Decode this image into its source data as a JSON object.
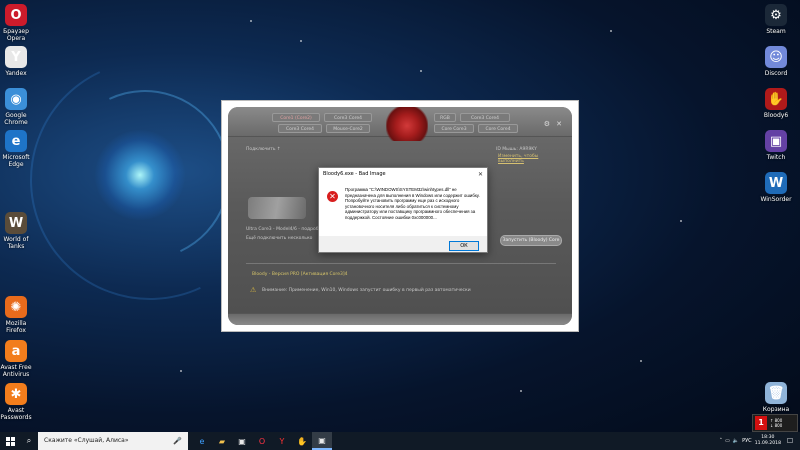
{
  "desktop": {
    "left_icons": [
      {
        "label": "Браузер\nOpera",
        "icon": "opera-icon",
        "color": "#cc1b2b",
        "glyph": "O"
      },
      {
        "label": "Yandex",
        "icon": "yandex-icon",
        "color": "#e8e8e8",
        "glyph": "Y"
      },
      {
        "label": "Google\nChrome",
        "icon": "chrome-icon",
        "color": "#3b8fd8",
        "glyph": "◉"
      },
      {
        "label": "Microsoft\nEdge",
        "icon": "edge-icon",
        "color": "#1e74c8",
        "glyph": "e"
      },
      {
        "label": "World of\nTanks",
        "icon": "world-of-tanks-icon",
        "color": "#5a4c3a",
        "glyph": "W"
      },
      {
        "label": "Mozilla\nFirefox",
        "icon": "firefox-icon",
        "color": "#e86b1c",
        "glyph": "✺"
      },
      {
        "label": "Avast Free\nAntivirus",
        "icon": "avast-icon",
        "color": "#f27d1c",
        "glyph": "a"
      },
      {
        "label": "Avast\nPasswords",
        "icon": "avast-passwords-icon",
        "color": "#f27d1c",
        "glyph": "✱"
      }
    ],
    "right_icons": [
      {
        "label": "Steam",
        "icon": "steam-icon",
        "color": "#1b2838",
        "glyph": "⚙"
      },
      {
        "label": "Discord",
        "icon": "discord-icon",
        "color": "#7289da",
        "glyph": "☺"
      },
      {
        "label": "Bloody6",
        "icon": "bloody-icon",
        "color": "#b01a1a",
        "glyph": "✋"
      },
      {
        "label": "Twitch",
        "icon": "twitch-icon",
        "color": "#6441a4",
        "glyph": "▣"
      },
      {
        "label": "WinSorder",
        "icon": "winsorder-icon",
        "color": "#1f6bb8",
        "glyph": "W"
      },
      {
        "label": "Корзина",
        "icon": "recycle-bin-icon",
        "color": "#8fb3d8",
        "glyph": "🗑"
      }
    ]
  },
  "app": {
    "tabs_row1": [
      "Core1 (Core2)",
      "Core3 Core4"
    ],
    "tabs_row2": [
      "Core3 Core4",
      "Mouse-Core2"
    ],
    "right_tabs_row1": [
      "RGB",
      "Core3 Core4"
    ],
    "right_tabs_row2": [
      "Core Core3",
      "Core Core4"
    ],
    "left_heading": "Подключить ↑",
    "right_status": "ID Мышь: A9R9KY",
    "right_link": "Изменить, чтобы\nвыполнить",
    "model_line": "Ultra Core3 - Model4/6 - подробнее",
    "sub_line": "Ещё подключить несколько",
    "gray_button": "Запустить (Bloody) Core",
    "version_line": "Bloody - Версия PRO [Активация Core3]4",
    "warning_line": "Внимание: Применение, Win10, Windows запустит ошибку в первый раз автоматически"
  },
  "dialog": {
    "title": "Bloody6.exe - Bad Image",
    "message": "Программа \"C:\\WINDOWS\\SYSTEM32\\winhtypes.dll\" не предназначена для выполнения в Windows или содержит ошибку. Попробуйте установить программу еще раз с исходного установочного носителя либо обратиться к системному администратору или поставщику программного обеспечения за поддержкой. Состояние ошибки 0xc000000...",
    "ok_label": "ОК"
  },
  "taskbar": {
    "search_placeholder": "Скажите «Слушай, Алиса»",
    "apps": [
      {
        "icon": "edge-icon",
        "glyph": "e",
        "color": "#3fa0ff",
        "active": false
      },
      {
        "icon": "file-explorer-icon",
        "glyph": "▰",
        "color": "#f2c14e",
        "active": false
      },
      {
        "icon": "store-icon",
        "glyph": "▣",
        "color": "#e8e8e8",
        "active": false
      },
      {
        "icon": "opera-icon",
        "glyph": "O",
        "color": "#ff3344",
        "active": false
      },
      {
        "icon": "yandex-icon",
        "glyph": "Y",
        "color": "#ff3333",
        "active": false
      },
      {
        "icon": "bloody-icon",
        "glyph": "✋",
        "color": "#d02020",
        "active": false
      },
      {
        "icon": "bloody-app-icon",
        "glyph": "▣",
        "color": "#e8e8e8",
        "active": true
      }
    ],
    "lang": "РУС",
    "time": "18:30",
    "date": "11.09.2018"
  },
  "net_meter": {
    "badge": "1",
    "upload": "↑ 800",
    "download": "↓ 800"
  }
}
